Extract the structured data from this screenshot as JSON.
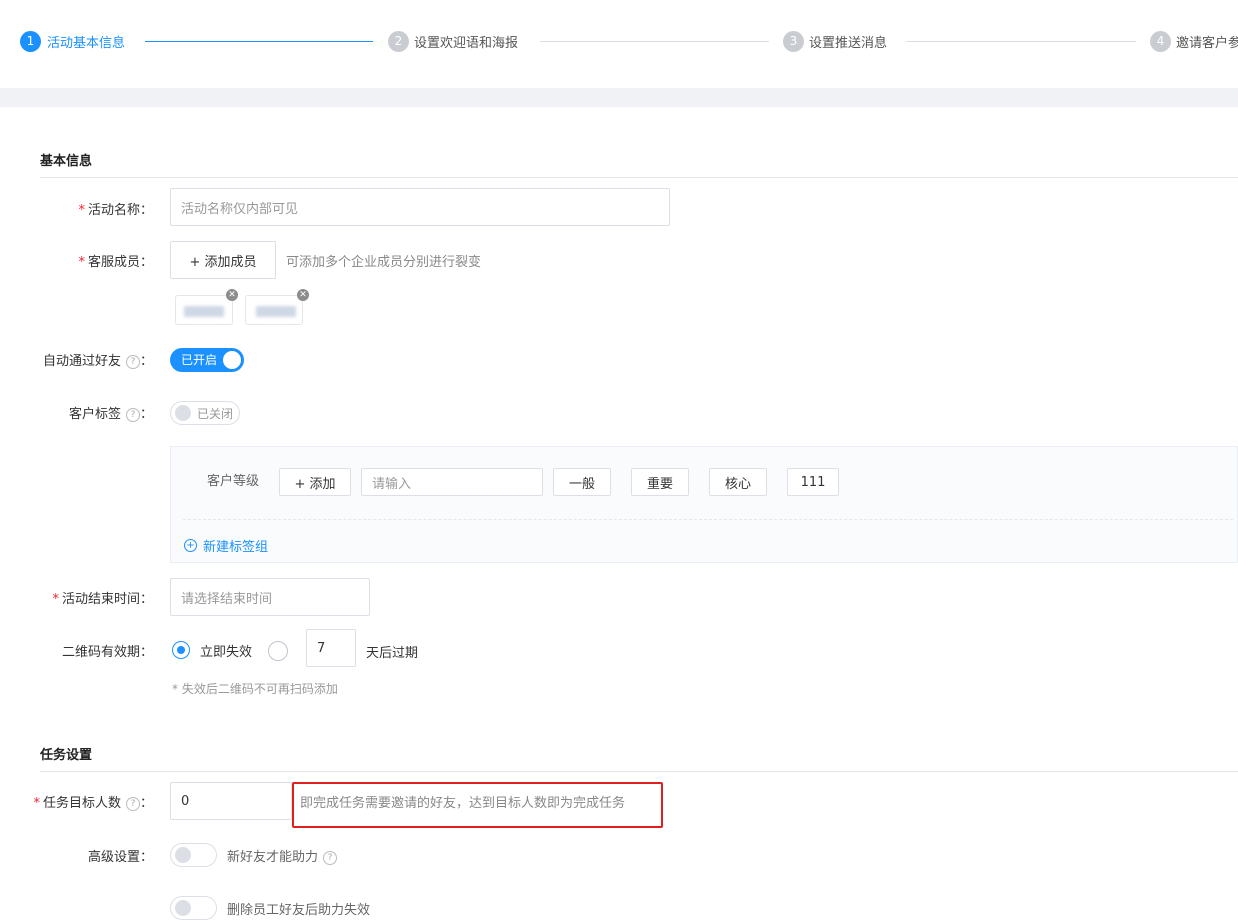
{
  "steps": [
    {
      "num": "1",
      "label": "活动基本信息"
    },
    {
      "num": "2",
      "label": "设置欢迎语和海报"
    },
    {
      "num": "3",
      "label": "设置推送消息"
    },
    {
      "num": "4",
      "label": "邀请客户参"
    }
  ],
  "basic": {
    "title": "基本信息",
    "activity_name": {
      "label": "活动名称：",
      "placeholder": "活动名称仅内部可见"
    },
    "staff": {
      "label": "客服成员：",
      "add_button": "+ 添加成员",
      "hint": "可添加多个企业成员分别进行裂变"
    },
    "auto_accept": {
      "label": "自动通过好友",
      "colon": "：",
      "toggle_text": "已开启"
    },
    "customer_tag": {
      "label": "客户标签",
      "colon": "：",
      "toggle_text": "已关闭"
    },
    "tag_group": {
      "group_label": "客户等级",
      "add_button": "+ 添加",
      "input_placeholder": "请输入",
      "tags": [
        "一般",
        "重要",
        "核心",
        "111"
      ],
      "new_group": "新建标签组"
    },
    "end_time": {
      "label": "活动结束时间：",
      "placeholder": "请选择结束时间"
    },
    "qr_valid": {
      "label": "二维码有效期：",
      "option_now": "立即失效",
      "days_value": "7",
      "days_suffix": "天后过期",
      "note": "* 失效后二维码不可再扫码添加"
    }
  },
  "task": {
    "title": "任务设置",
    "target": {
      "label": "任务目标人数",
      "colon": "：",
      "value": "0",
      "hint": "即完成任务需要邀请的好友，达到目标人数即为完成任务"
    },
    "advanced": {
      "label": "高级设置：",
      "option1": "新好友才能助力",
      "option2": "删除员工好友后助力失效"
    }
  },
  "colors": {
    "accent": "#1a91ff",
    "required": "#f5222d",
    "highlight_box": "#e02020"
  },
  "icons": {
    "help": "help-circle-icon",
    "plus_circle": "plus-circle-icon",
    "remove": "close-circle-icon"
  }
}
